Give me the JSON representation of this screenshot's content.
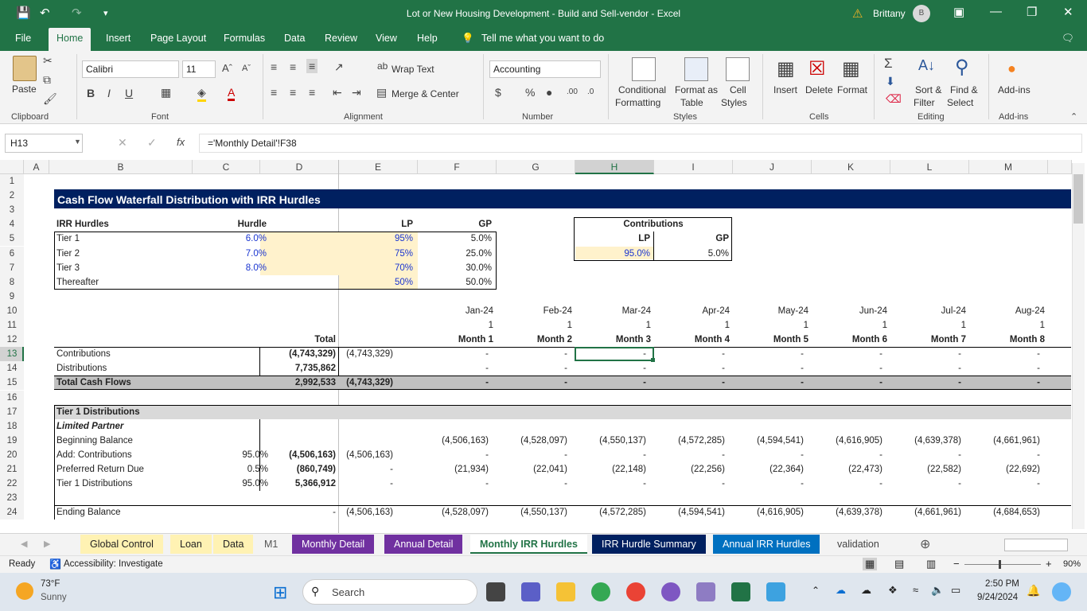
{
  "window": {
    "title": "Lot or New Housing Development - Build and Sell-vendor  -  Excel",
    "user": "Brittany",
    "avatar_initial": "B"
  },
  "menu": {
    "file": "File",
    "home": "Home",
    "insert": "Insert",
    "page_layout": "Page Layout",
    "formulas": "Formulas",
    "data": "Data",
    "review": "Review",
    "view": "View",
    "help": "Help",
    "tell": "Tell me what you want to do"
  },
  "ribbon": {
    "paste": "Paste",
    "clipboard": "Clipboard",
    "font_name": "Calibri",
    "font_size": "11",
    "font": "Font",
    "alignment": "Alignment",
    "wrap_text": "Wrap Text",
    "merge_center": "Merge & Center",
    "number_format": "Accounting",
    "number": "Number",
    "cond_format": "Conditional",
    "cond_format2": "Formatting",
    "format_table": "Format as",
    "format_table2": "Table",
    "cell_styles": "Cell",
    "cell_styles2": "Styles",
    "styles": "Styles",
    "insert": "Insert",
    "delete": "Delete",
    "format": "Format",
    "cells": "Cells",
    "sort_filter": "Sort &",
    "sort_filter2": "Filter",
    "find_select": "Find &",
    "find_select2": "Select",
    "editing": "Editing",
    "addins": "Add-ins",
    "addins_group": "Add-ins"
  },
  "formula_bar": {
    "name_box": "H13",
    "formula": "='Monthly Detail'!F38",
    "fx": "fx"
  },
  "columns": [
    "A",
    "B",
    "C",
    "D",
    "E",
    "F",
    "G",
    "H",
    "I",
    "J",
    "K",
    "L",
    "M"
  ],
  "rows": [
    "1",
    "2",
    "3",
    "4",
    "5",
    "6",
    "7",
    "8",
    "9",
    "10",
    "11",
    "12",
    "13",
    "14",
    "15",
    "16",
    "17",
    "18",
    "19",
    "20",
    "21",
    "22",
    "23",
    "24"
  ],
  "sheet": {
    "title": "Cash Flow Waterfall Distribution with IRR Hurdles",
    "hurdle_table": {
      "headers": [
        "IRR Hurdles",
        "Hurdle",
        "LP",
        "GP"
      ],
      "rows": [
        [
          "Tier 1",
          "6.0%",
          "95%",
          "5.0%"
        ],
        [
          "Tier 2",
          "7.0%",
          "75%",
          "25.0%"
        ],
        [
          "Tier 3",
          "8.0%",
          "70%",
          "30.0%"
        ],
        [
          "Thereafter",
          "",
          "50%",
          "50.0%"
        ]
      ]
    },
    "contrib_table": {
      "title": "Contributions",
      "lp_label": "LP",
      "gp_label": "GP",
      "lp": "95.0%",
      "gp": "5.0%"
    },
    "dates": [
      "Jan-24",
      "Feb-24",
      "Mar-24",
      "Apr-24",
      "May-24",
      "Jun-24",
      "Jul-24",
      "Aug-24"
    ],
    "ones": [
      "1",
      "1",
      "1",
      "1",
      "1",
      "1",
      "1",
      "1"
    ],
    "months": [
      "Month 1",
      "Month 2",
      "Month 3",
      "Month 4",
      "Month 5",
      "Month 6",
      "Month 7",
      "Month 8"
    ],
    "total_label": "Total",
    "cash_rows": [
      {
        "label": "Contributions",
        "total": "(4,743,329)",
        "e": "(4,743,329)",
        "vals": [
          "-",
          "-",
          "-",
          "-",
          "-",
          "-",
          "-",
          "-"
        ]
      },
      {
        "label": "Distributions",
        "total": "7,735,862",
        "e": "",
        "vals": [
          "-",
          "-",
          "-",
          "-",
          "-",
          "-",
          "-",
          "-"
        ]
      },
      {
        "label": "Total Cash Flows",
        "total": "2,992,533",
        "e": "(4,743,329)",
        "vals": [
          "-",
          "-",
          "-",
          "-",
          "-",
          "-",
          "-",
          "-"
        ]
      }
    ],
    "tier1": {
      "title": "Tier 1 Distributions",
      "subtitle": "Limited Partner",
      "rows": [
        {
          "label": "Beginning Balance",
          "c": "",
          "d": "",
          "e": "",
          "vals": [
            "(4,506,163)",
            "(4,528,097)",
            "(4,550,137)",
            "(4,572,285)",
            "(4,594,541)",
            "(4,616,905)",
            "(4,639,378)",
            "(4,661,961)"
          ]
        },
        {
          "label": "Add: Contributions",
          "c": "95.0%",
          "d": "(4,506,163)",
          "e": "(4,506,163)",
          "vals": [
            "-",
            "-",
            "-",
            "-",
            "-",
            "-",
            "-",
            "-"
          ]
        },
        {
          "label": "Preferred Return Due",
          "c": "0.5%",
          "d": "(860,749)",
          "e": "-",
          "vals": [
            "(21,934)",
            "(22,041)",
            "(22,148)",
            "(22,256)",
            "(22,364)",
            "(22,473)",
            "(22,582)",
            "(22,692)"
          ]
        },
        {
          "label": "Tier 1 Distributions",
          "c": "95.0%",
          "d": "5,366,912",
          "e": "-",
          "vals": [
            "-",
            "-",
            "-",
            "-",
            "-",
            "-",
            "-",
            "-"
          ]
        }
      ],
      "ending": {
        "label": "Ending Balance",
        "d": "-",
        "e": "(4,506,163)",
        "vals": [
          "(4,528,097)",
          "(4,550,137)",
          "(4,572,285)",
          "(4,594,541)",
          "(4,616,905)",
          "(4,639,378)",
          "(4,661,961)",
          "(4,684,653)"
        ]
      }
    }
  },
  "sheet_tabs": [
    {
      "label": "Global Control",
      "bg": "#fff2b3",
      "fg": "#222"
    },
    {
      "label": "Loan",
      "bg": "#fff2b3",
      "fg": "#222"
    },
    {
      "label": "Data",
      "bg": "#fff2b3",
      "fg": "#222"
    },
    {
      "label": "M1",
      "bg": "#f3f3f3",
      "fg": "#555"
    },
    {
      "label": "Monthly Detail",
      "bg": "#7030a0",
      "fg": "#fff"
    },
    {
      "label": "Annual Detail",
      "bg": "#7030a0",
      "fg": "#fff"
    },
    {
      "label": "Monthly IRR Hurdles",
      "bg": "#fff",
      "fg": "#217346"
    },
    {
      "label": "IRR Hurdle Summary",
      "bg": "#002060",
      "fg": "#fff"
    },
    {
      "label": "Annual IRR Hurdles",
      "bg": "#0070c0",
      "fg": "#fff"
    },
    {
      "label": "validation",
      "bg": "#f3f3f3",
      "fg": "#444"
    }
  ],
  "status": {
    "ready": "Ready",
    "accessibility": "Accessibility: Investigate",
    "zoom": "90%"
  },
  "taskbar": {
    "temp": "73°F",
    "weather": "Sunny",
    "search": "Search",
    "time": "2:50 PM",
    "date": "9/24/2024"
  },
  "colors": {
    "excel_green": "#217346",
    "title_navy": "#002060",
    "input_yellow": "#fff2cc",
    "gray_band": "#c0c0c0"
  }
}
